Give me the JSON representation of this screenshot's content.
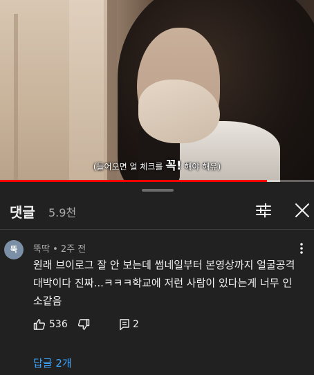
{
  "video": {
    "subtitle_prefix": "(들어오면 얼 체크를 ",
    "subtitle_emphasis": "꼭!",
    "subtitle_suffix": " 해야 해유)",
    "progress_fraction": 0.85
  },
  "comments_header": {
    "title": "댓글",
    "count": "5.9천"
  },
  "comment": {
    "avatar_text": "뚝",
    "author": "뚝딱",
    "time": "2주 전",
    "text": "원래 브이로그 잘 안 보는데 썸네일부터 본영상까지 얼굴공격 대박이다 진짜...ㅋㅋㅋ학교에 저런 사람이 있다는게 너무 인소같음",
    "likes": "536",
    "reply_count": "2",
    "replies_link": "답글 2개"
  },
  "colors": {
    "background": "#212121",
    "text_primary": "#f1f1f1",
    "text_secondary": "#aaaaaa",
    "link": "#3ea6ff",
    "progress": "#ff0000",
    "avatar": "#7b8fa6"
  },
  "icons": {
    "filter": "filter-sliders-icon",
    "close": "close-icon",
    "more": "more-vert-icon",
    "like": "thumb-up-icon",
    "dislike": "thumb-down-icon",
    "reply": "comment-reply-icon"
  }
}
